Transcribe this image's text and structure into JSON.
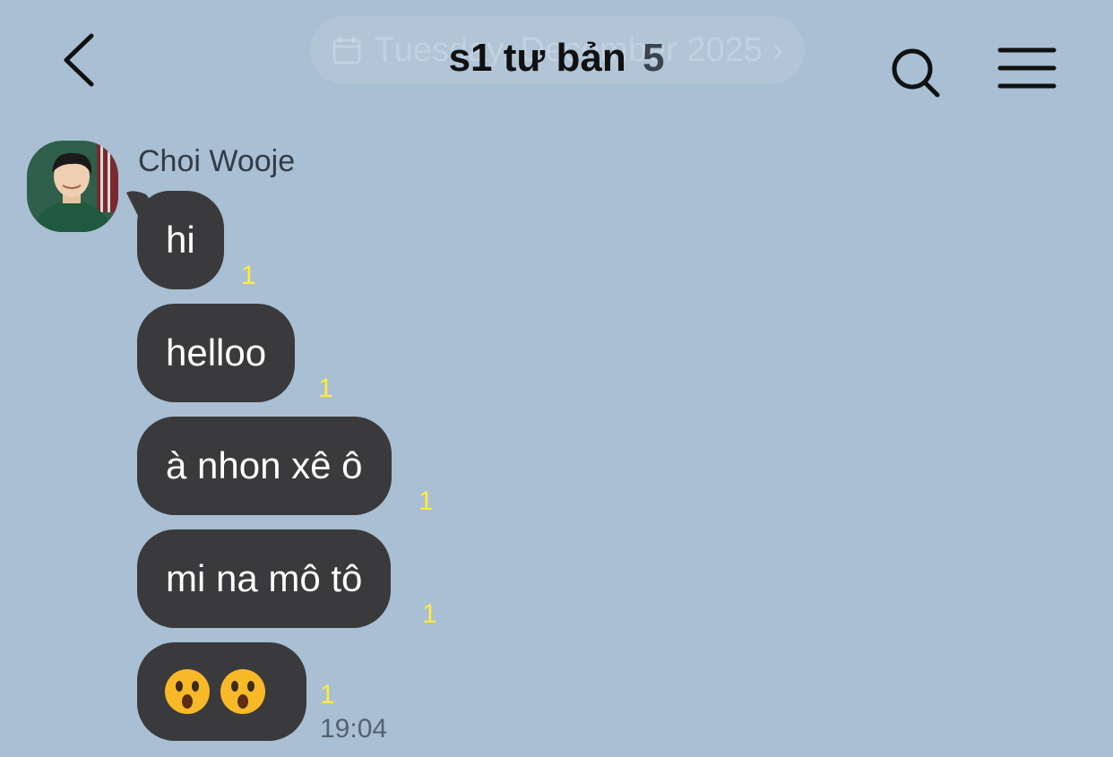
{
  "header": {
    "title": "s1 tư bản",
    "member_count": "5",
    "date_pill": "Tuesday, December 2025 ›",
    "back_icon": "chevron-left-icon",
    "search_icon": "search-icon",
    "menu_icon": "hamburger-menu-icon"
  },
  "sender": {
    "name": "Choi Wooje"
  },
  "messages": [
    {
      "text": "hi",
      "unread": "1"
    },
    {
      "text": "helloo",
      "unread": "1"
    },
    {
      "text": "à nhon xê ô",
      "unread": "1"
    },
    {
      "text": "mi na mô tô",
      "unread": "1"
    },
    {
      "text": "😯😯",
      "unread": "1",
      "time": "19:04"
    }
  ],
  "colors": {
    "background": "#a9bfd3",
    "bubble": "#3a3a3c",
    "unread": "#ffeb3b"
  }
}
